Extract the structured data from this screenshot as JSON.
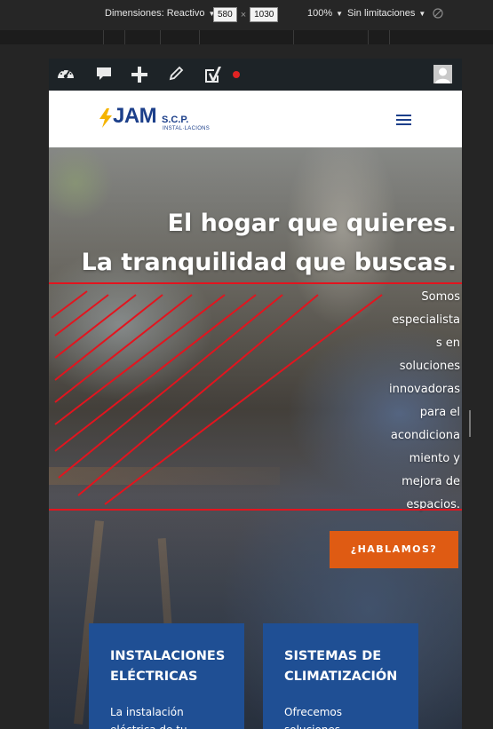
{
  "devtools": {
    "dimensions_label": "Dimensiones: Reactivo",
    "width": "580",
    "separator": "×",
    "height": "1030",
    "zoom": "100%",
    "throttle": "Sin limitaciones"
  },
  "adminbar": {
    "icons": [
      "dashboard-icon",
      "comment-icon",
      "plus-icon",
      "pencil-icon",
      "yoast-seo-icon",
      "status-dot-icon",
      "user-avatar-icon"
    ],
    "status_color": "#e02323"
  },
  "header": {
    "logo_main": "JAM",
    "logo_suffix": "S.C.P.",
    "logo_tagline": "INSTAL·LACIONS",
    "menu_icon": "hamburger-icon",
    "brand_color": "#1c3f8a",
    "bolt_color": "#f5b400"
  },
  "hero": {
    "heading_line1": "El hogar que quieres.",
    "heading_line2": "La tranquilidad que buscas.",
    "lead_lines": [
      "Somos",
      "especialista",
      "s en",
      "soluciones",
      "innovadoras",
      "para el",
      "acondiciona",
      "miento y",
      "mejora de",
      "espacios."
    ],
    "cta_label": "¿HABLAMOS?",
    "cta_color": "#df5b13",
    "overlay_color": "#e3141e"
  },
  "cards": [
    {
      "title_line1": "INSTALACIONES",
      "title_line2": "ELÉCTRICAS",
      "desc_line1": "La instalación",
      "desc_line2": "eléctrica de tu"
    },
    {
      "title_line1": "SISTEMAS DE",
      "title_line2": "CLIMATIZACIÓN",
      "desc_line1": "Ofrecemos",
      "desc_line2": "soluciones"
    }
  ],
  "card_color": "#1f4f94"
}
